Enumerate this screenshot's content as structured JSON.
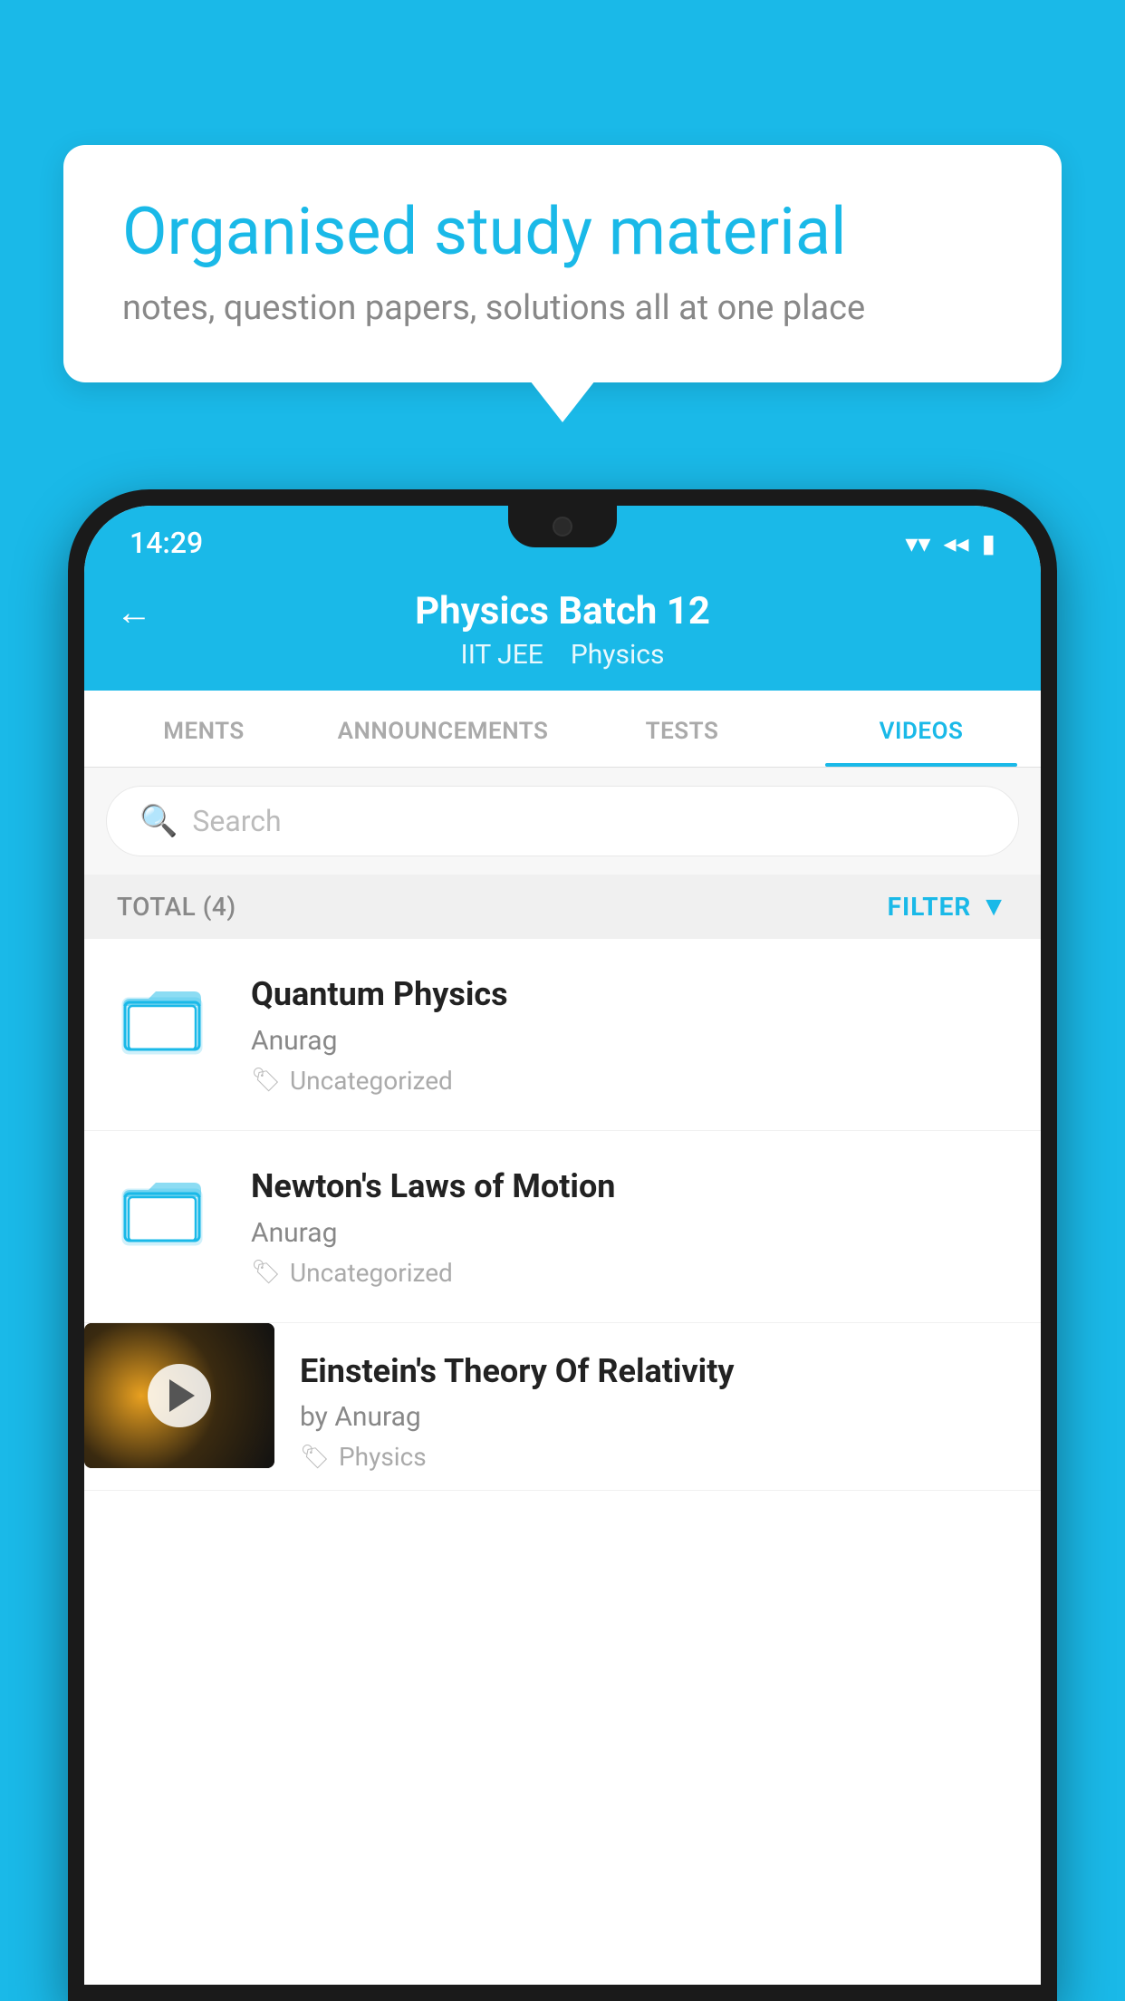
{
  "background_color": "#1ab9e8",
  "bubble": {
    "title": "Organised study material",
    "subtitle": "notes, question papers, solutions all at one place"
  },
  "status_bar": {
    "time": "14:29",
    "wifi": "▼",
    "signal": "▲",
    "battery": "▮"
  },
  "header": {
    "title": "Physics Batch 12",
    "tag1": "IIT JEE",
    "tag2": "Physics",
    "back_label": "←"
  },
  "tabs": [
    {
      "label": "MENTS",
      "active": false
    },
    {
      "label": "ANNOUNCEMENTS",
      "active": false
    },
    {
      "label": "TESTS",
      "active": false
    },
    {
      "label": "VIDEOS",
      "active": true
    }
  ],
  "search": {
    "placeholder": "Search"
  },
  "filter_bar": {
    "total": "TOTAL (4)",
    "filter_label": "FILTER"
  },
  "videos": [
    {
      "title": "Quantum Physics",
      "author": "Anurag",
      "tag": "Uncategorized",
      "type": "folder",
      "has_thumbnail": false
    },
    {
      "title": "Newton's Laws of Motion",
      "author": "Anurag",
      "tag": "Uncategorized",
      "type": "folder",
      "has_thumbnail": false
    },
    {
      "title": "Einstein's Theory Of Relativity",
      "author": "by Anurag",
      "tag": "Physics",
      "type": "video",
      "has_thumbnail": true
    }
  ]
}
